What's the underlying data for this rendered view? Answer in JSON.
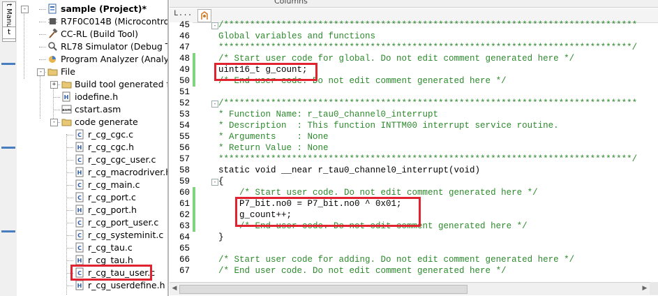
{
  "side_tab": {
    "label": "t Manual",
    "glyph": "t"
  },
  "tree": {
    "items": [
      {
        "label": "sample (Project)*",
        "icon": "project-icon",
        "bold": true
      },
      {
        "label": "R7F0C014B (Microcontroll",
        "icon": "chip-icon"
      },
      {
        "label": "CC-RL (Build Tool)",
        "icon": "hammer-icon"
      },
      {
        "label": "RL78 Simulator (Debug To",
        "icon": "debug-icon"
      },
      {
        "label": "Program Analyzer (Analyz",
        "icon": "analyzer-icon"
      },
      {
        "label": "File",
        "icon": "folder-icon"
      },
      {
        "label": "Build tool generated fi",
        "icon": "folder-icon"
      },
      {
        "label": "iodefine.h",
        "icon": "h-file-icon"
      },
      {
        "label": "cstart.asm",
        "icon": "asm-file-icon"
      },
      {
        "label": "code generate",
        "icon": "folder-icon"
      },
      {
        "label": "r_cg_cgc.c",
        "icon": "c-file-icon"
      },
      {
        "label": "r_cg_cgc.h",
        "icon": "h-file-icon"
      },
      {
        "label": "r_cg_cgc_user.c",
        "icon": "c-file-icon"
      },
      {
        "label": "r_cg_macrodriver.h",
        "icon": "h-file-icon"
      },
      {
        "label": "r_cg_main.c",
        "icon": "c-file-icon"
      },
      {
        "label": "r_cg_port.c",
        "icon": "c-file-icon"
      },
      {
        "label": "r_cg_port.h",
        "icon": "h-file-icon"
      },
      {
        "label": "r_cg_port_user.c",
        "icon": "c-file-icon"
      },
      {
        "label": "r_cg_systeminit.c",
        "icon": "c-file-icon"
      },
      {
        "label": "r_cg_tau.c",
        "icon": "c-file-icon"
      },
      {
        "label": "r_cg_tau.h",
        "icon": "h-file-icon"
      },
      {
        "label": "r_cg_tau_user.c",
        "icon": "c-file-icon"
      },
      {
        "label": "r_cg_userdefine.h",
        "icon": "h-file-icon"
      }
    ]
  },
  "editor": {
    "toolbar_label": "Columns",
    "header_label": "L...",
    "lines": [
      {
        "no": "45",
        "text": "/*******************************************************************************",
        "type": "cm"
      },
      {
        "no": "46",
        "text": "Global variables and functions",
        "type": "cm"
      },
      {
        "no": "47",
        "text": "*******************************************************************************/",
        "type": "cm"
      },
      {
        "no": "48",
        "text": "/* Start user code for global. Do not edit comment generated here */",
        "type": "cm"
      },
      {
        "no": "49",
        "text": "uint16_t g_count;",
        "type": "kw"
      },
      {
        "no": "50",
        "text": "/* End user code. Do not edit comment generated here */",
        "type": "cm"
      },
      {
        "no": "51",
        "text": "",
        "type": "kw"
      },
      {
        "no": "52",
        "text": "/*******************************************************************************",
        "type": "cm"
      },
      {
        "no": "53",
        "text": "* Function Name: r_tau0_channel0_interrupt",
        "type": "cm"
      },
      {
        "no": "54",
        "text": "* Description  : This function INTTM00 interrupt service routine.",
        "type": "cm"
      },
      {
        "no": "55",
        "text": "* Arguments    : None",
        "type": "cm"
      },
      {
        "no": "56",
        "text": "* Return Value : None",
        "type": "cm"
      },
      {
        "no": "57",
        "text": "*******************************************************************************/",
        "type": "cm"
      },
      {
        "no": "58",
        "text": "static void __near r_tau0_channel0_interrupt(void)",
        "type": "kw"
      },
      {
        "no": "59",
        "text": "{",
        "type": "kw"
      },
      {
        "no": "60",
        "text": "    /* Start user code. Do not edit comment generated here */",
        "type": "cm"
      },
      {
        "no": "61",
        "text": "    P7_bit.no0 = P7_bit.no0 ^ 0x01;",
        "type": "kw"
      },
      {
        "no": "62",
        "text": "    g_count++;",
        "type": "kw"
      },
      {
        "no": "63",
        "text": "    /* End user code. Do not edit comment generated here */",
        "type": "cm"
      },
      {
        "no": "64",
        "text": "}",
        "type": "kw"
      },
      {
        "no": "65",
        "text": "",
        "type": "kw"
      },
      {
        "no": "66",
        "text": "/* Start user code for adding. Do not edit comment generated here */",
        "type": "cm"
      },
      {
        "no": "67",
        "text": "/* End user code. Do not edit comment generated here */",
        "type": "cm"
      }
    ]
  },
  "colors": {
    "highlight": "#e0232e",
    "comment": "#2c8a2c",
    "change_bar": "#7fd47f"
  }
}
